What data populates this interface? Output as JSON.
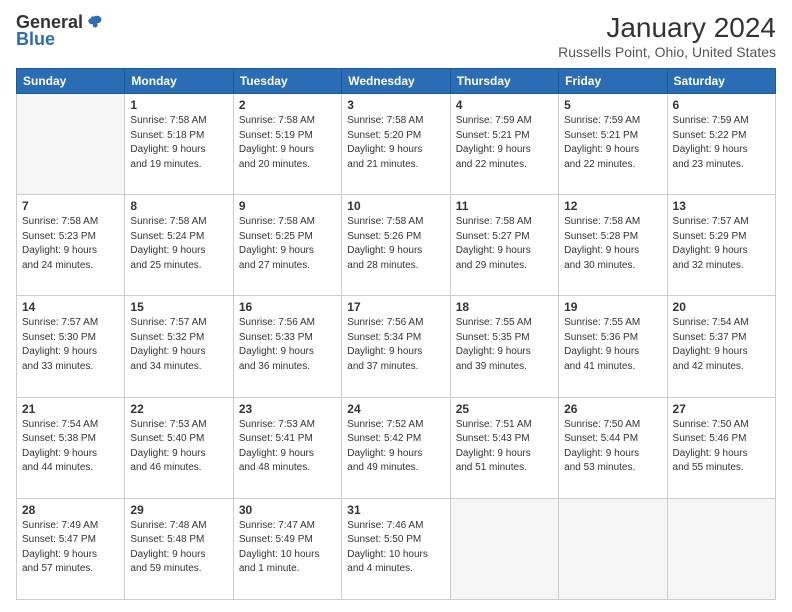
{
  "logo": {
    "general": "General",
    "blue": "Blue"
  },
  "title": "January 2024",
  "location": "Russells Point, Ohio, United States",
  "days_header": [
    "Sunday",
    "Monday",
    "Tuesday",
    "Wednesday",
    "Thursday",
    "Friday",
    "Saturday"
  ],
  "weeks": [
    [
      {
        "day": "",
        "info": ""
      },
      {
        "day": "1",
        "info": "Sunrise: 7:58 AM\nSunset: 5:18 PM\nDaylight: 9 hours\nand 19 minutes."
      },
      {
        "day": "2",
        "info": "Sunrise: 7:58 AM\nSunset: 5:19 PM\nDaylight: 9 hours\nand 20 minutes."
      },
      {
        "day": "3",
        "info": "Sunrise: 7:58 AM\nSunset: 5:20 PM\nDaylight: 9 hours\nand 21 minutes."
      },
      {
        "day": "4",
        "info": "Sunrise: 7:59 AM\nSunset: 5:21 PM\nDaylight: 9 hours\nand 22 minutes."
      },
      {
        "day": "5",
        "info": "Sunrise: 7:59 AM\nSunset: 5:21 PM\nDaylight: 9 hours\nand 22 minutes."
      },
      {
        "day": "6",
        "info": "Sunrise: 7:59 AM\nSunset: 5:22 PM\nDaylight: 9 hours\nand 23 minutes."
      }
    ],
    [
      {
        "day": "7",
        "info": "Sunrise: 7:58 AM\nSunset: 5:23 PM\nDaylight: 9 hours\nand 24 minutes."
      },
      {
        "day": "8",
        "info": "Sunrise: 7:58 AM\nSunset: 5:24 PM\nDaylight: 9 hours\nand 25 minutes."
      },
      {
        "day": "9",
        "info": "Sunrise: 7:58 AM\nSunset: 5:25 PM\nDaylight: 9 hours\nand 27 minutes."
      },
      {
        "day": "10",
        "info": "Sunrise: 7:58 AM\nSunset: 5:26 PM\nDaylight: 9 hours\nand 28 minutes."
      },
      {
        "day": "11",
        "info": "Sunrise: 7:58 AM\nSunset: 5:27 PM\nDaylight: 9 hours\nand 29 minutes."
      },
      {
        "day": "12",
        "info": "Sunrise: 7:58 AM\nSunset: 5:28 PM\nDaylight: 9 hours\nand 30 minutes."
      },
      {
        "day": "13",
        "info": "Sunrise: 7:57 AM\nSunset: 5:29 PM\nDaylight: 9 hours\nand 32 minutes."
      }
    ],
    [
      {
        "day": "14",
        "info": "Sunrise: 7:57 AM\nSunset: 5:30 PM\nDaylight: 9 hours\nand 33 minutes."
      },
      {
        "day": "15",
        "info": "Sunrise: 7:57 AM\nSunset: 5:32 PM\nDaylight: 9 hours\nand 34 minutes."
      },
      {
        "day": "16",
        "info": "Sunrise: 7:56 AM\nSunset: 5:33 PM\nDaylight: 9 hours\nand 36 minutes."
      },
      {
        "day": "17",
        "info": "Sunrise: 7:56 AM\nSunset: 5:34 PM\nDaylight: 9 hours\nand 37 minutes."
      },
      {
        "day": "18",
        "info": "Sunrise: 7:55 AM\nSunset: 5:35 PM\nDaylight: 9 hours\nand 39 minutes."
      },
      {
        "day": "19",
        "info": "Sunrise: 7:55 AM\nSunset: 5:36 PM\nDaylight: 9 hours\nand 41 minutes."
      },
      {
        "day": "20",
        "info": "Sunrise: 7:54 AM\nSunset: 5:37 PM\nDaylight: 9 hours\nand 42 minutes."
      }
    ],
    [
      {
        "day": "21",
        "info": "Sunrise: 7:54 AM\nSunset: 5:38 PM\nDaylight: 9 hours\nand 44 minutes."
      },
      {
        "day": "22",
        "info": "Sunrise: 7:53 AM\nSunset: 5:40 PM\nDaylight: 9 hours\nand 46 minutes."
      },
      {
        "day": "23",
        "info": "Sunrise: 7:53 AM\nSunset: 5:41 PM\nDaylight: 9 hours\nand 48 minutes."
      },
      {
        "day": "24",
        "info": "Sunrise: 7:52 AM\nSunset: 5:42 PM\nDaylight: 9 hours\nand 49 minutes."
      },
      {
        "day": "25",
        "info": "Sunrise: 7:51 AM\nSunset: 5:43 PM\nDaylight: 9 hours\nand 51 minutes."
      },
      {
        "day": "26",
        "info": "Sunrise: 7:50 AM\nSunset: 5:44 PM\nDaylight: 9 hours\nand 53 minutes."
      },
      {
        "day": "27",
        "info": "Sunrise: 7:50 AM\nSunset: 5:46 PM\nDaylight: 9 hours\nand 55 minutes."
      }
    ],
    [
      {
        "day": "28",
        "info": "Sunrise: 7:49 AM\nSunset: 5:47 PM\nDaylight: 9 hours\nand 57 minutes."
      },
      {
        "day": "29",
        "info": "Sunrise: 7:48 AM\nSunset: 5:48 PM\nDaylight: 9 hours\nand 59 minutes."
      },
      {
        "day": "30",
        "info": "Sunrise: 7:47 AM\nSunset: 5:49 PM\nDaylight: 10 hours\nand 1 minute."
      },
      {
        "day": "31",
        "info": "Sunrise: 7:46 AM\nSunset: 5:50 PM\nDaylight: 10 hours\nand 4 minutes."
      },
      {
        "day": "",
        "info": ""
      },
      {
        "day": "",
        "info": ""
      },
      {
        "day": "",
        "info": ""
      }
    ]
  ]
}
